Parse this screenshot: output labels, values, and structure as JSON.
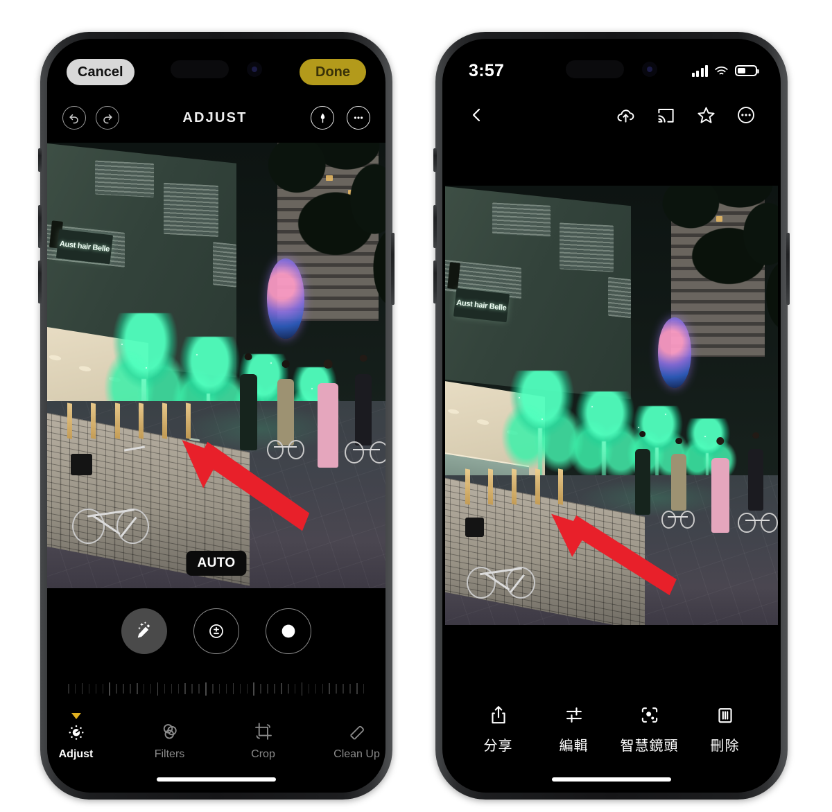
{
  "meta": {
    "accent_yellow": "#b39a1b",
    "caret_yellow": "#e0b020",
    "arrow_red": "#e8202a",
    "screen_black": "#000000"
  },
  "left_phone": {
    "screen_name": "photo-editor-adjust",
    "top": {
      "cancel_label": "Cancel",
      "done_label": "Done"
    },
    "tools": {
      "undo_icon": "undo-icon",
      "redo_icon": "redo-icon",
      "title": "ADJUST",
      "markup_icon": "markup-pen-icon",
      "more_icon": "more-ellipsis-icon"
    },
    "photo": {
      "alt": "night street with green LED lit trees, bicycle against brick wall",
      "sign_text": "Aust hair Belle",
      "badge": "AUTO",
      "annotation": "red-arrow-pointing-to-bicycle"
    },
    "adjust_controls": [
      {
        "name": "auto-enhance",
        "icon": "magic-wand-icon",
        "selected": true
      },
      {
        "name": "exposure",
        "icon": "plus-minus-circle-icon",
        "selected": false
      },
      {
        "name": "brilliance",
        "icon": "contrast-circle-icon",
        "selected": false
      }
    ],
    "slider": {
      "name": "intensity-ruler",
      "ticks": 44
    },
    "tabs": [
      {
        "label": "Adjust",
        "icon": "dial-icon",
        "active": true
      },
      {
        "label": "Filters",
        "icon": "filters-icon",
        "active": false
      },
      {
        "label": "Crop",
        "icon": "crop-icon",
        "active": false
      },
      {
        "label": "Clean Up",
        "icon": "eraser-icon",
        "active": false
      }
    ]
  },
  "right_phone": {
    "screen_name": "photo-viewer",
    "statusbar": {
      "time": "3:57",
      "cellular_icon": "cellular-bars-icon",
      "wifi_icon": "wifi-icon",
      "battery_icon": "battery-icon",
      "battery_level": "45"
    },
    "topbar": {
      "back_icon": "chevron-left-icon",
      "actions": [
        {
          "name": "backup-cloud-icon"
        },
        {
          "name": "cast-icon"
        },
        {
          "name": "favorite-star-icon"
        },
        {
          "name": "more-ellipsis-icon"
        }
      ]
    },
    "photo": {
      "alt": "night street with green LED lit trees, bicycle against brick wall",
      "sign_text": "Aust hair Belle",
      "annotation": "red-arrow-pointing-to-bicycle"
    },
    "bottombar": [
      {
        "label": "分享",
        "icon": "share-icon"
      },
      {
        "label": "編輯",
        "icon": "edit-sliders-icon"
      },
      {
        "label": "智慧鏡頭",
        "icon": "lens-icon"
      },
      {
        "label": "刪除",
        "icon": "trash-icon"
      }
    ]
  }
}
